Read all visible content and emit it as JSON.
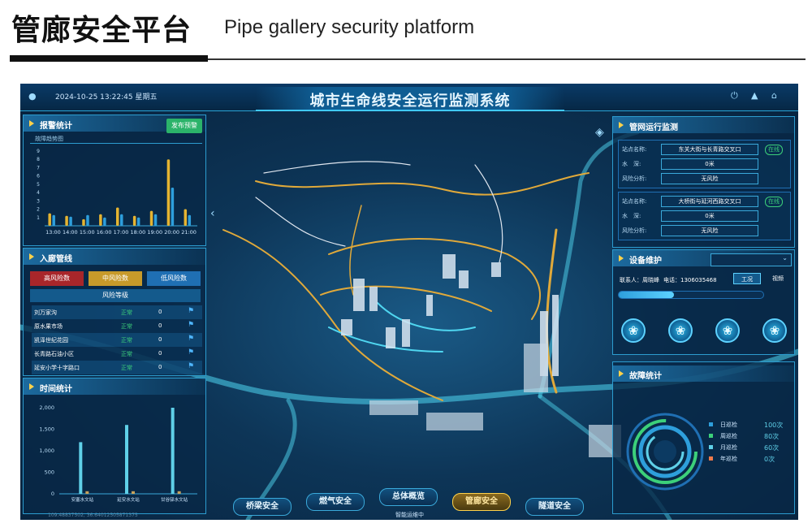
{
  "header": {
    "title_cn": "管廊安全平台",
    "title_en": "Pipe gallery security platform"
  },
  "topbar": {
    "datetime": "2024-10-25  13:22:45  星期五",
    "system_title": "城市生命线安全运行监测系统"
  },
  "alarm_panel": {
    "title": "报警统计",
    "publish_button": "发布预警",
    "subtitle": "故障趋势图",
    "chart_data": {
      "type": "bar",
      "categories": [
        "13:00",
        "14:00",
        "15:00",
        "16:00",
        "17:00",
        "18:00",
        "19:00",
        "20:00",
        "21:00"
      ],
      "series": [
        {
          "values": [
            1.5,
            1.2,
            0.8,
            1.4,
            2.2,
            1.2,
            1.8,
            8.0,
            2.0
          ],
          "color": "#e5b431"
        },
        {
          "values": [
            1.3,
            1.1,
            1.3,
            1.0,
            1.4,
            1.0,
            1.4,
            4.6,
            1.3
          ],
          "color": "#2e9fdc"
        }
      ],
      "ylim": [
        0,
        9
      ],
      "yticks": [
        "1",
        "2",
        "3",
        "4",
        "5",
        "6",
        "7",
        "8",
        "9"
      ]
    }
  },
  "corridor_panel": {
    "title": "入廊管线",
    "risk_tabs": [
      "高风险数",
      "中风险数",
      "低风险数"
    ],
    "risk_level_header": "风险等级",
    "rows": [
      {
        "name": "刘万家沟",
        "status": "正常",
        "count": "0"
      },
      {
        "name": "原水果市场",
        "status": "正常",
        "count": "0"
      },
      {
        "name": "凯泽世纪花园",
        "status": "正常",
        "count": "0"
      },
      {
        "name": "长青路石油小区",
        "status": "正常",
        "count": "0"
      },
      {
        "name": "延安小学十字路口",
        "status": "正常",
        "count": "0"
      }
    ]
  },
  "time_panel": {
    "title": "时间统计",
    "chart_data": {
      "type": "bar",
      "categories": [
        "安塞水文站",
        "延安水文站",
        "甘谷驿水文站"
      ],
      "series": [
        {
          "values": [
            1200,
            1600,
            2000
          ],
          "color": "#5fd0e8"
        },
        {
          "values": [
            60,
            60,
            60
          ],
          "color": "#c9a25a"
        }
      ],
      "ylim": [
        0,
        2000
      ],
      "yticks": [
        "0",
        "500",
        "1,000",
        "1,500",
        "2,000"
      ]
    }
  },
  "monitor_panel": {
    "title": "管网运行监测",
    "stations": [
      {
        "site_label": "站点名称:",
        "site": "东关大街与长青路交叉口",
        "status": "在线",
        "depth_label": "水　深:",
        "depth": "0米",
        "risk_label": "风险分析:",
        "risk": "无风险"
      },
      {
        "site_label": "站点名称:",
        "site": "大桥街与延河西路交叉口",
        "status": "在线",
        "depth_label": "水　深:",
        "depth": "0米",
        "risk_label": "风险分析:",
        "risk": "无风险"
      }
    ]
  },
  "maintenance_panel": {
    "title": "设备维护",
    "contact": "联系人：周晓峰",
    "phone": "电话：1306035468",
    "tab_active": "工况",
    "tab_other": "视频"
  },
  "fault_panel": {
    "title": "故障统计",
    "legend": [
      {
        "label": "日巡检",
        "value": "100次",
        "color": "#2e9fdc"
      },
      {
        "label": "周巡检",
        "value": "80次",
        "color": "#3cd07a"
      },
      {
        "label": "月巡检",
        "value": "60次",
        "color": "#5fd0e8"
      },
      {
        "label": "年巡检",
        "value": "0次",
        "color": "#f07a4a"
      }
    ]
  },
  "bottom_nav": [
    "桥梁安全",
    "燃气安全",
    "总体概览",
    "管廊安全",
    "隧道安全"
  ],
  "bottom_status": "智能运维中",
  "coordinates": "109.48837502, 36.64012505871375"
}
